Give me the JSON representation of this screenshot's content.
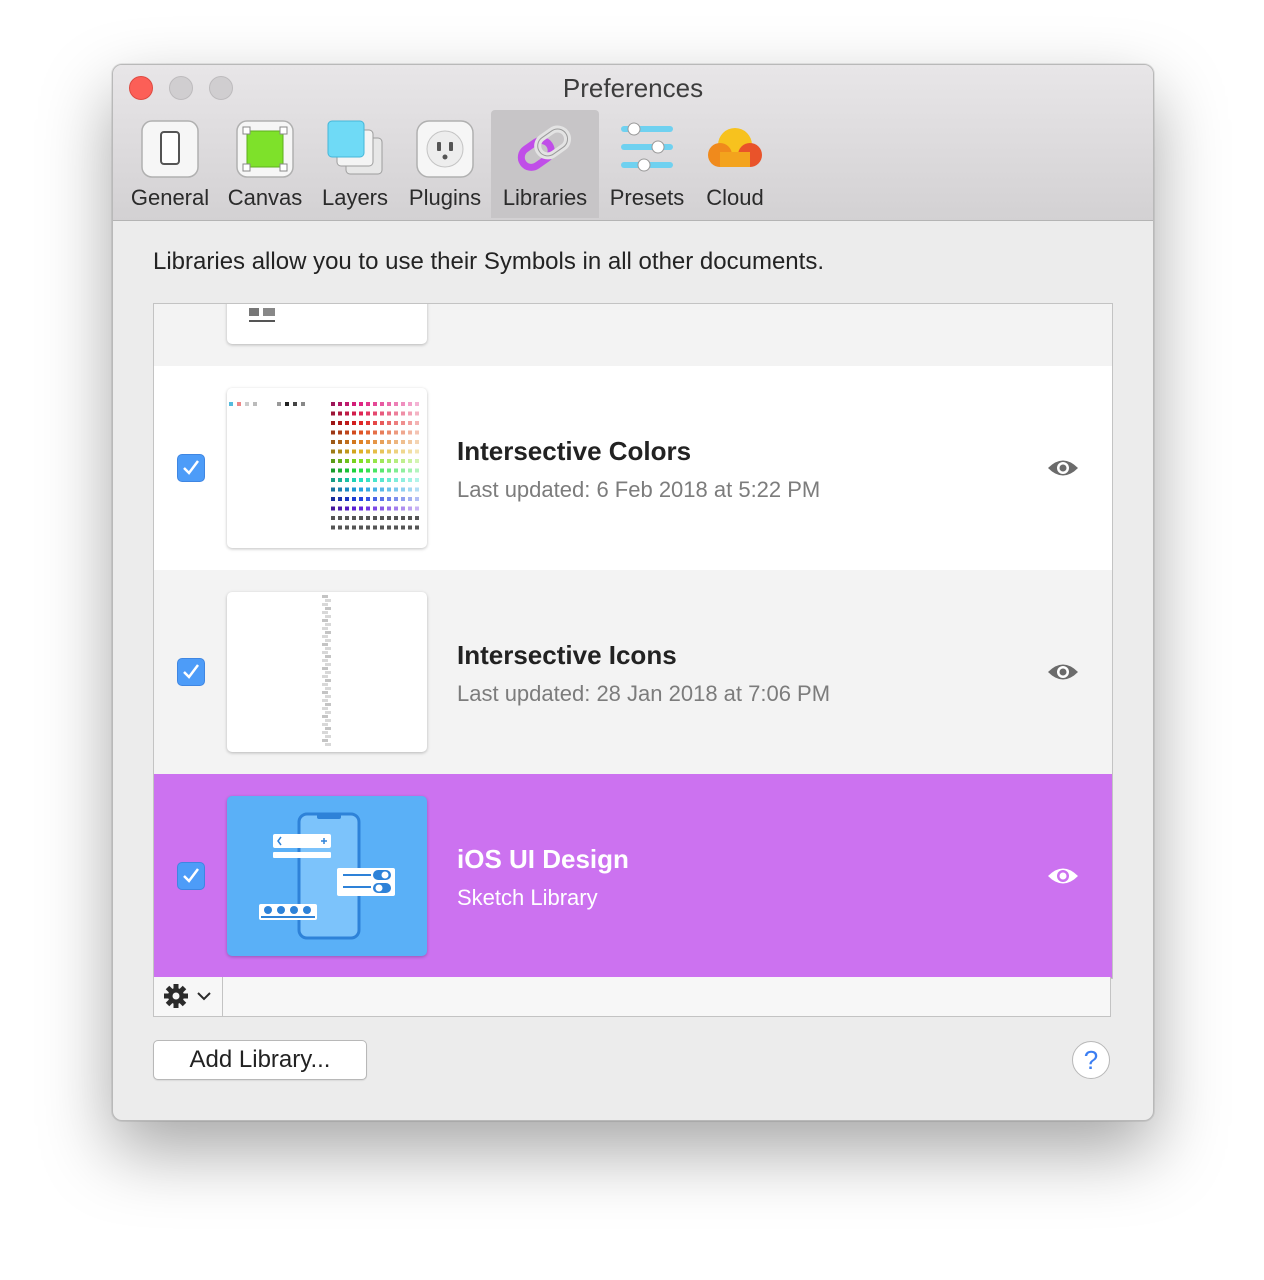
{
  "window": {
    "title": "Preferences"
  },
  "tabs": [
    {
      "label": "General",
      "icon": "general-icon"
    },
    {
      "label": "Canvas",
      "icon": "canvas-icon"
    },
    {
      "label": "Layers",
      "icon": "layers-icon"
    },
    {
      "label": "Plugins",
      "icon": "plugins-icon"
    },
    {
      "label": "Libraries",
      "icon": "libraries-icon",
      "active": true
    },
    {
      "label": "Presets",
      "icon": "presets-icon"
    },
    {
      "label": "Cloud",
      "icon": "cloud-icon"
    }
  ],
  "content": {
    "description": "Libraries allow you to use their Symbols in all other documents."
  },
  "libraries": [
    {
      "name": "Intersective Colors",
      "subtitle": "Last updated: 6 Feb 2018 at 5:22 PM",
      "checked": true
    },
    {
      "name": "Intersective Icons",
      "subtitle": "Last updated: 28 Jan 2018 at 7:06 PM",
      "checked": true
    },
    {
      "name": "iOS UI Design",
      "subtitle": "Sketch Library",
      "checked": true,
      "selected": true
    }
  ],
  "footer": {
    "add_button": "Add Library...",
    "help_button": "?"
  },
  "colors": {
    "selected_row": "#cc72f0",
    "checkbox": "#4d9cf8",
    "close_button": "#fc5f57"
  }
}
